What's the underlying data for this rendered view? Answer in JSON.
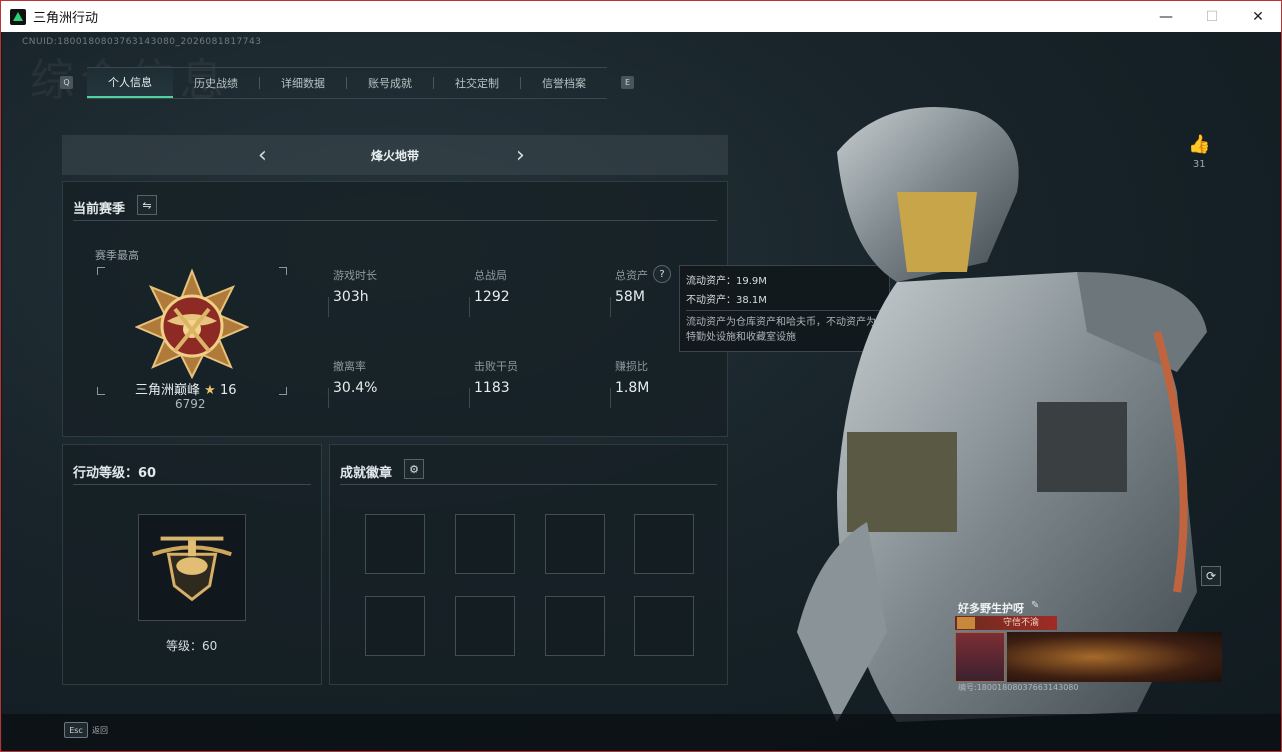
{
  "window": {
    "title": "三角洲行动",
    "minimize": "—",
    "maximize": "☐",
    "close": "✕"
  },
  "uid": "CNUID:1800180803763143080_2026081817743",
  "bg_watermark": "综合信息",
  "tabs": [
    {
      "label": "个人信息",
      "active": true
    },
    {
      "label": "历史战绩"
    },
    {
      "label": "详细数据"
    },
    {
      "label": "账号成就"
    },
    {
      "label": "社交定制"
    },
    {
      "label": "信誉档案"
    }
  ],
  "tab_keys": {
    "left": "Q",
    "right": "E"
  },
  "mode_selector": {
    "label": "烽火地带",
    "prev": "‹",
    "next": "›"
  },
  "season": {
    "title": "当前赛季",
    "best_label": "赛季最高",
    "rank_name": "三角洲巅峰",
    "rank_stars": "16",
    "rank_score": "6792",
    "stats": [
      {
        "label": "游戏时长",
        "value": "303h"
      },
      {
        "label": "总战局",
        "value": "1292"
      },
      {
        "label": "总资产",
        "value": "58M"
      },
      {
        "label": "撤离率",
        "value": "30.4%"
      },
      {
        "label": "击败干员",
        "value": "1183"
      },
      {
        "label": "赚损比",
        "value": "1.8M"
      }
    ]
  },
  "tooltip": {
    "liquid": "流动资产：19.9M",
    "fixed": "不动资产：38.1M",
    "desc": "流动资产为仓库资产和哈夫币，不动资产为特勤处设施和收藏室设施"
  },
  "action_level": {
    "title": "行动等级：60",
    "level_text": "等级：60"
  },
  "badges": {
    "title": "成就徽章",
    "slots": 8
  },
  "likes": {
    "count": "31"
  },
  "player_card": {
    "name": "好多野生护呀",
    "tag": "守信不渝",
    "id": "编号:18001808037663143080"
  },
  "bottom": {
    "esc_key": "Esc",
    "esc_label": "返回"
  }
}
